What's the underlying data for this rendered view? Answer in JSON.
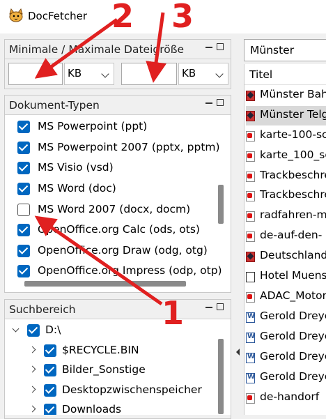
{
  "app": {
    "title": "DocFetcher"
  },
  "colors": {
    "accent": "#0067c0",
    "annotation": "#e02020",
    "selection": "#cce4f7"
  },
  "filesize": {
    "title": "Minimale / Maximale Dateigröße",
    "min_value": "",
    "min_unit": "KB",
    "max_value": "",
    "max_unit": "KB"
  },
  "doctypes": {
    "title": "Dokument-Typen",
    "items": [
      {
        "label": "MS Powerpoint (ppt)",
        "checked": true
      },
      {
        "label": "MS Powerpoint 2007 (pptx, pptm)",
        "checked": true
      },
      {
        "label": "MS Visio (vsd)",
        "checked": true
      },
      {
        "label": "MS Word (doc)",
        "checked": true
      },
      {
        "label": "MS Word 2007 (docx, docm)",
        "checked": false
      },
      {
        "label": "OpenOffice.org Calc (ods, ots)",
        "checked": true
      },
      {
        "label": "OpenOffice.org Draw (odg, otg)",
        "checked": true
      },
      {
        "label": "OpenOffice.org Impress (odp, otp)",
        "checked": true
      }
    ]
  },
  "scope": {
    "title": "Suchbereich",
    "root": "D:\\",
    "children": [
      "$RECYCLE.BIN",
      "Bilder_Sonstige",
      "Desktopzwischenspeicher",
      "Downloads"
    ]
  },
  "search": {
    "query": "Münster"
  },
  "results": {
    "column_title": "Titel",
    "rows": [
      {
        "title": "Münster Bahnhof",
        "icon": "image-icon"
      },
      {
        "title": "Münster Telgte",
        "icon": "image-icon"
      },
      {
        "title": "karte-100-sc",
        "icon": "pdf-icon"
      },
      {
        "title": "karte_100_sc",
        "icon": "pdf-icon"
      },
      {
        "title": "Trackbeschreibung",
        "icon": "pdf-icon"
      },
      {
        "title": "Trackbeschreibung",
        "icon": "pdf-icon"
      },
      {
        "title": "radfahren-m",
        "icon": "pdf-icon"
      },
      {
        "title": "de-auf-den-",
        "icon": "pdf-icon"
      },
      {
        "title": "Deutschland",
        "icon": "image-icon"
      },
      {
        "title": "Hotel Muenster",
        "icon": "html-icon"
      },
      {
        "title": "ADAC_Motor",
        "icon": "pdf-icon"
      },
      {
        "title": "Gerold Dreyer",
        "icon": "doc-icon"
      },
      {
        "title": "Gerold Dreyer",
        "icon": "doc-icon"
      },
      {
        "title": "Gerold Dreyer",
        "icon": "doc-icon"
      },
      {
        "title": "Gerold Dreyer",
        "icon": "doc-icon"
      },
      {
        "title": "de-handorf",
        "icon": "pdf-icon"
      }
    ]
  },
  "annotations": {
    "one": "1",
    "two": "2",
    "three": "3"
  }
}
